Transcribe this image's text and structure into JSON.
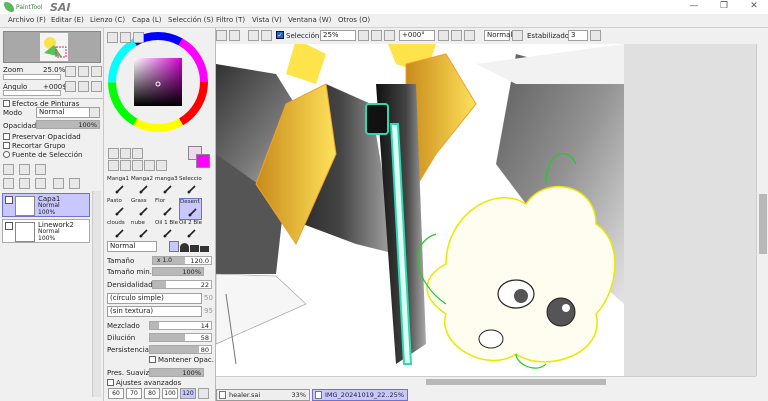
{
  "app": {
    "logo_small": "PaintTool",
    "logo_big": "SAI"
  },
  "window_buttons": [
    "—",
    "❐",
    "✕"
  ],
  "menu": [
    "Archivo (F)",
    "Editar (E)",
    "Lienzo (C)",
    "Capa (L)",
    "Selección (S)",
    "Filtro (T)",
    "Vista (V)",
    "Ventana (W)",
    "Otros (O)"
  ],
  "navigator": {
    "zoom_label": "Zoom",
    "zoom_value": "25.0%",
    "angle_label": "Ángulo",
    "angle_value": "+000$"
  },
  "effects": {
    "header": "Efectos de Pinturas",
    "mode_label": "Modo",
    "mode_value": "Normal",
    "opacity_label": "Opacidad",
    "opacity_value": "100%",
    "opacity_fill": 1.0,
    "options": [
      "Preservar Opacidad",
      "Recortar Grupo",
      "Fuente de Selección"
    ]
  },
  "layers": [
    {
      "name": "Capa1",
      "mode": "Normal",
      "opacity": "100%",
      "selected": true
    },
    {
      "name": "Linework2",
      "mode": "Normal",
      "opacity": "100%",
      "selected": false
    }
  ],
  "tools": [
    [
      "Manga1",
      "Manga2",
      "manga3",
      "Seleccio"
    ],
    [
      "Pasto",
      "Grass",
      "Flor",
      "Desenf."
    ],
    [
      "clouds",
      "nube",
      "Oil 1 Ble",
      "Oil 2 Ble"
    ]
  ],
  "brush": {
    "mode": "Normal",
    "size_label": "Tamaño",
    "size_mult": "x 1.0",
    "size_value": "120.0",
    "size_fill": 0.55,
    "minsize_label": "Tamaño min.",
    "minsize_value": "100%",
    "minsize_fill": 1.0,
    "density_label": "Densidalidad",
    "density_value": "22",
    "density_fill": 0.22,
    "shape": "(círculo simple)",
    "shape_val": "50",
    "texture": "(sin textura)",
    "texture_val": "95",
    "blend_label": "Mezclado",
    "blend_value": "14",
    "blend_fill": 0.14,
    "dilution_label": "Dilución",
    "dilution_value": "58",
    "dilution_fill": 0.58,
    "persistence_label": "Persistencia",
    "persistence_value": "80",
    "persistence_fill": 0.8,
    "keep_opacity": "Mantener Opac.",
    "smooth_label": "Pres. Suavizado",
    "smooth_value": "100%",
    "smooth_fill": 1.0,
    "advanced": "Ajustes avanzados",
    "presets": [
      "60",
      "70",
      "80",
      "100",
      "120"
    ]
  },
  "toolbar": {
    "selection_label": "Selección",
    "zoom_value": "25%",
    "angle_value": "+000°",
    "mode_value": "Normal",
    "stabilizer_label": "Estabilizador",
    "stabilizer_value": "3"
  },
  "tabs": [
    {
      "name": "healer.sai",
      "zoom": "33%"
    },
    {
      "name": "IMG_20241019_22...",
      "zoom": "25%"
    }
  ],
  "colors": {
    "accent": "#ff00ff",
    "layer_select": "#c8c8ff"
  }
}
